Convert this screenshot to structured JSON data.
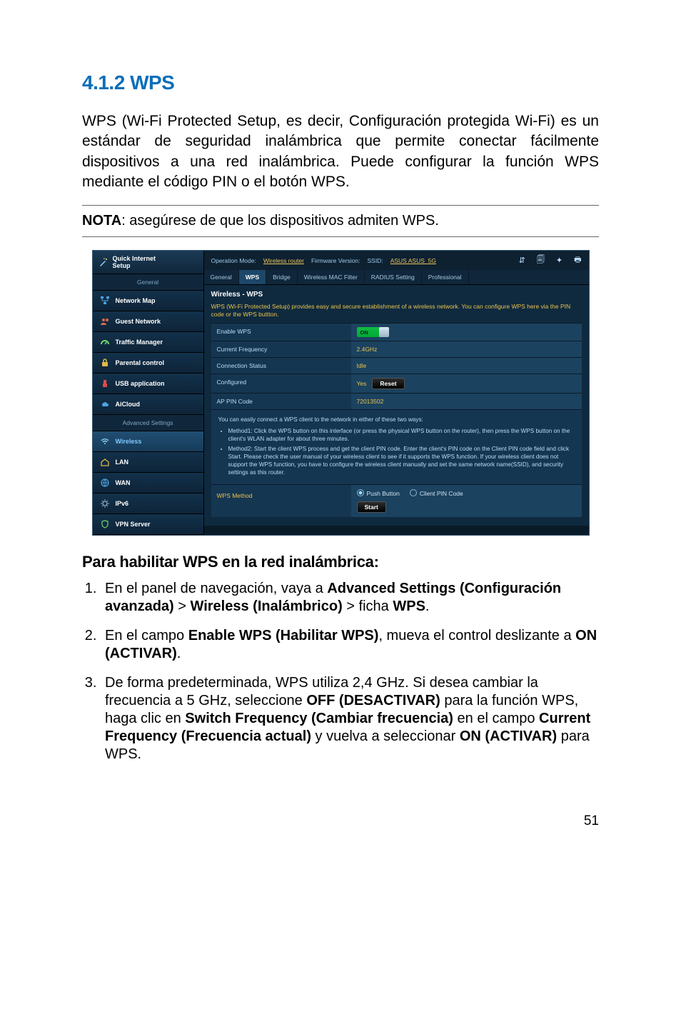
{
  "section_number": "4.1.2",
  "section_name": "WPS",
  "intro": "WPS (Wi-Fi Protected Setup, es decir, Configuración protegida Wi-Fi) es un estándar de seguridad inalámbrica que permite conectar fácilmente dispositivos a una red inalámbrica. Puede configurar la función WPS mediante el código PIN o el botón WPS.",
  "note_label": "NOTA",
  "note_text": ":  asegúrese de que los dispositivos admiten WPS.",
  "router": {
    "qis_line1": "Quick Internet",
    "qis_line2": "Setup",
    "side_general": "General",
    "nav": [
      "Network Map",
      "Guest Network",
      "Traffic Manager",
      "Parental control",
      "USB application",
      "AiCloud"
    ],
    "side_adv": "Advanced Settings",
    "adv": [
      "Wireless",
      "LAN",
      "WAN",
      "IPv6",
      "VPN Server"
    ],
    "top_mode_label": "Operation Mode:",
    "top_mode_value": "Wireless router",
    "top_fw_label": "Firmware Version:",
    "top_ssid_label": "SSID:",
    "top_ssid_value": "ASUS  ASUS_5G",
    "tabs": [
      "General",
      "WPS",
      "Bridge",
      "Wireless MAC Filter",
      "RADIUS Setting",
      "Professional"
    ],
    "panel_title": "Wireless - WPS",
    "panel_desc": "WPS (Wi-Fi Protected Setup) provides easy and secure establishment of a wireless network. You can configure WPS here via the PIN code or the WPS buttton.",
    "rows": {
      "enable_label": "Enable WPS",
      "enable_value": "ON",
      "freq_label": "Current Frequency",
      "freq_value": "2.4GHz",
      "status_label": "Connection Status",
      "status_value": "Idle",
      "conf_label": "Configured",
      "conf_value": "Yes",
      "reset_btn": "Reset",
      "pin_label": "AP PIN Code",
      "pin_value": "72013502"
    },
    "help_intro": "You can easily connect a WPS client to the network in either of these two ways:",
    "help_m1": "Method1: Click the WPS button on this interface (or press the physical WPS button on the router), then press the WPS button on the client's WLAN adapter for about three minutes.",
    "help_m2": "Method2: Start the client WPS process and get the client PIN code. Enter the client's PIN code on the Client PIN code field and click Start. Please check the user manual of your wireless client to see if it supports the WPS function. If your wireless client does not support the WPS function, you have to configure the wireless client manually and set the same network name(SSID), and security settings as this router.",
    "method_label": "WPS Method",
    "radio_push": "Push Button",
    "radio_pin": "Client PIN Code",
    "start_btn": "Start"
  },
  "steps_title": "Para habilitar WPS en la red inalámbrica:",
  "steps": {
    "s1_a": "En el panel de navegación, vaya a ",
    "s1_b": "Advanced Settings (Configuración avanzada)",
    "s1_c": " > ",
    "s1_d": "Wireless (Inalámbrico)",
    "s1_e": " > ficha ",
    "s1_f": "WPS",
    "s1_g": ".",
    "s2_a": "En el campo ",
    "s2_b": "Enable WPS (Habilitar WPS)",
    "s2_c": ", mueva el control deslizante a ",
    "s2_d": "ON (ACTIVAR)",
    "s2_e": ".",
    "s3_a": "De forma predeterminada, WPS utiliza 2,4 GHz. Si desea cambiar la frecuencia a 5 GHz, seleccione ",
    "s3_b": "OFF (DESACTIVAR)",
    "s3_c": " para la función WPS, haga clic en ",
    "s3_d": "Switch Frequency (Cambiar frecuencia)",
    "s3_e": " en el campo ",
    "s3_f": "Current Frequency (Frecuencia actual)",
    "s3_g": " y vuelva a seleccionar ",
    "s3_h": "ON (ACTIVAR)",
    "s3_i": " para WPS."
  },
  "page_number": "51"
}
